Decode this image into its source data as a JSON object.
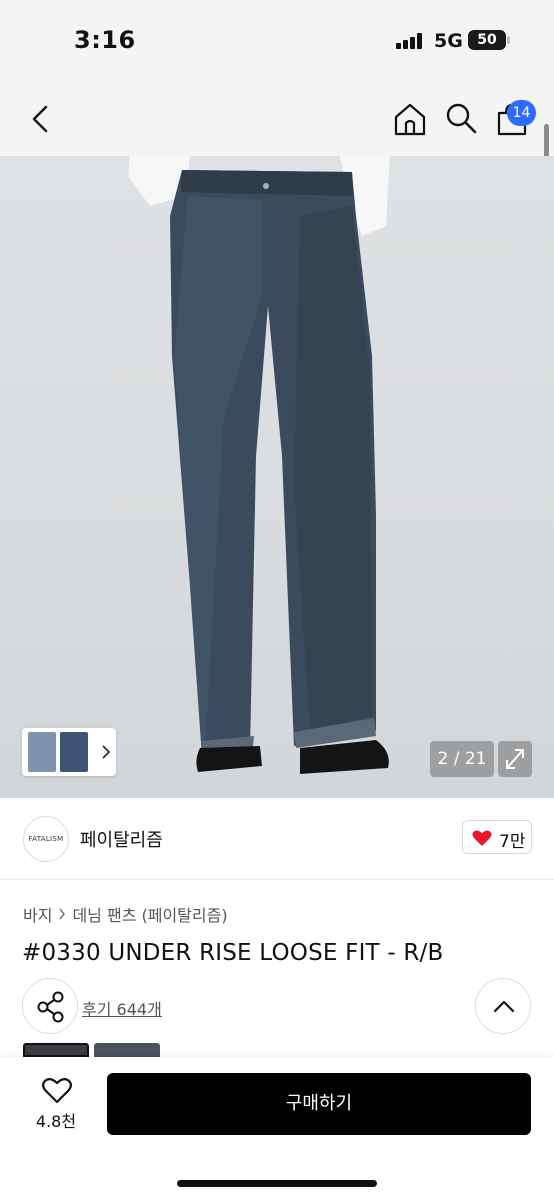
{
  "status_bar": {
    "time": "3:16",
    "network": "5G",
    "battery": "50"
  },
  "nav": {
    "cart_count": "14"
  },
  "gallery": {
    "page_counter": "2 / 21"
  },
  "brand": {
    "logo_text": "FATALISM",
    "name": "페이탈리즘",
    "likes": "7만"
  },
  "breadcrumb": {
    "level1": "바지",
    "level2": "데님 팬츠 (페이탈리즘)"
  },
  "product": {
    "title": "#0330 UNDER RISE LOOSE FIT - R/B",
    "review_link": "후기 644개"
  },
  "bottom_bar": {
    "wish_count": "4.8천",
    "buy_label": "구매하기"
  },
  "colors": {
    "accent_badge": "#2f6bff",
    "like_heart": "#e8182a",
    "buy_button": "#000000"
  },
  "icons": [
    "back-arrow-icon",
    "home-icon",
    "search-icon",
    "cart-icon",
    "expand-icon",
    "heart-icon",
    "share-icon",
    "chevron-up-icon"
  ]
}
